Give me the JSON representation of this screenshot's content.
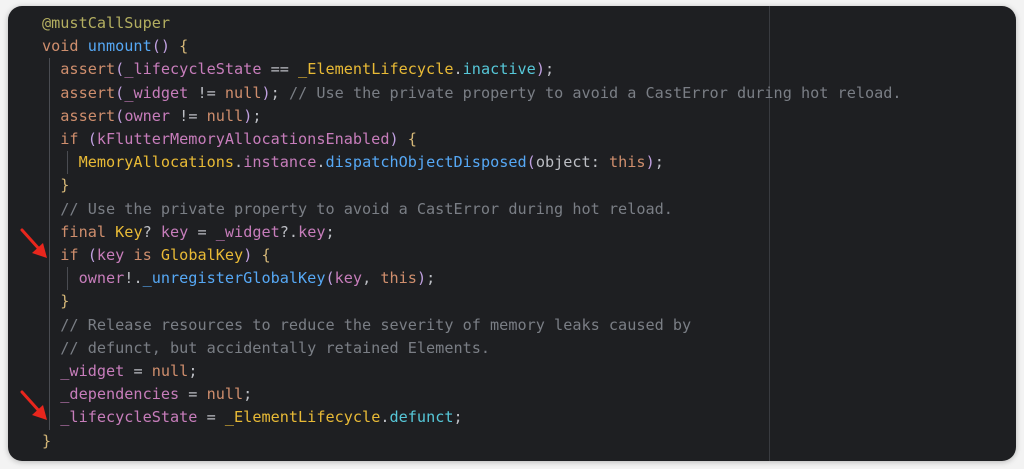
{
  "editor": {
    "lines": [
      [
        {
          "t": "@mustCallSuper",
          "c": "anno"
        }
      ],
      [
        {
          "t": "void ",
          "c": "kw"
        },
        {
          "t": "unmount",
          "c": "fn"
        },
        {
          "t": "() ",
          "c": "paren"
        },
        {
          "t": "{",
          "c": "brace"
        }
      ],
      [
        {
          "t": "  assert",
          "c": "kw"
        },
        {
          "t": "(",
          "c": "paren"
        },
        {
          "t": "_lifecycleState",
          "c": "priv"
        },
        {
          "t": " == ",
          "c": "punc"
        },
        {
          "t": "_ElementLifecycle",
          "c": "cls"
        },
        {
          "t": ".",
          "c": "punc"
        },
        {
          "t": "inactive",
          "c": "prop"
        },
        {
          "t": ")",
          "c": "paren"
        },
        {
          "t": ";",
          "c": "punc"
        }
      ],
      [
        {
          "t": "  assert",
          "c": "kw"
        },
        {
          "t": "(",
          "c": "paren"
        },
        {
          "t": "_widget",
          "c": "priv"
        },
        {
          "t": " != ",
          "c": "punc"
        },
        {
          "t": "null",
          "c": "kw"
        },
        {
          "t": ")",
          "c": "paren"
        },
        {
          "t": "; ",
          "c": "punc"
        },
        {
          "t": "// Use the private property to avoid a CastError during hot reload.",
          "c": "cm"
        }
      ],
      [
        {
          "t": "  assert",
          "c": "kw"
        },
        {
          "t": "(",
          "c": "paren"
        },
        {
          "t": "owner",
          "c": "priv"
        },
        {
          "t": " != ",
          "c": "punc"
        },
        {
          "t": "null",
          "c": "kw"
        },
        {
          "t": ")",
          "c": "paren"
        },
        {
          "t": ";",
          "c": "punc"
        }
      ],
      [
        {
          "t": "  if ",
          "c": "kw"
        },
        {
          "t": "(",
          "c": "paren"
        },
        {
          "t": "kFlutterMemoryAllocationsEnabled",
          "c": "priv"
        },
        {
          "t": ") ",
          "c": "paren"
        },
        {
          "t": "{",
          "c": "brace"
        }
      ],
      [
        {
          "t": "    MemoryAllocations",
          "c": "cls"
        },
        {
          "t": ".",
          "c": "punc"
        },
        {
          "t": "instance",
          "c": "priv"
        },
        {
          "t": ".",
          "c": "punc"
        },
        {
          "t": "dispatchObjectDisposed",
          "c": "fn"
        },
        {
          "t": "(",
          "c": "paren"
        },
        {
          "t": "object: ",
          "c": "named"
        },
        {
          "t": "this",
          "c": "this"
        },
        {
          "t": ")",
          "c": "paren"
        },
        {
          "t": ";",
          "c": "punc"
        }
      ],
      [
        {
          "t": "  }",
          "c": "brace"
        }
      ],
      [
        {
          "t": "  // Use the private property to avoid a CastError during hot reload.",
          "c": "cm"
        }
      ],
      [
        {
          "t": "  final ",
          "c": "kw"
        },
        {
          "t": "Key",
          "c": "cls"
        },
        {
          "t": "? ",
          "c": "punc"
        },
        {
          "t": "key",
          "c": "priv"
        },
        {
          "t": " = ",
          "c": "punc"
        },
        {
          "t": "_widget",
          "c": "priv"
        },
        {
          "t": "?.",
          "c": "punc"
        },
        {
          "t": "key",
          "c": "priv"
        },
        {
          "t": ";",
          "c": "punc"
        }
      ],
      [
        {
          "t": "  if ",
          "c": "kw"
        },
        {
          "t": "(",
          "c": "paren"
        },
        {
          "t": "key",
          "c": "priv"
        },
        {
          "t": " is ",
          "c": "kw"
        },
        {
          "t": "GlobalKey",
          "c": "cls"
        },
        {
          "t": ") ",
          "c": "paren"
        },
        {
          "t": "{",
          "c": "brace"
        }
      ],
      [
        {
          "t": "    owner",
          "c": "priv"
        },
        {
          "t": "!.",
          "c": "punc"
        },
        {
          "t": "_unregisterGlobalKey",
          "c": "fn"
        },
        {
          "t": "(",
          "c": "paren"
        },
        {
          "t": "key",
          "c": "priv"
        },
        {
          "t": ", ",
          "c": "punc"
        },
        {
          "t": "this",
          "c": "this"
        },
        {
          "t": ")",
          "c": "paren"
        },
        {
          "t": ";",
          "c": "punc"
        }
      ],
      [
        {
          "t": "  }",
          "c": "brace"
        }
      ],
      [
        {
          "t": "  // Release resources to reduce the severity of memory leaks caused by",
          "c": "cm"
        }
      ],
      [
        {
          "t": "  // defunct, but accidentally retained Elements.",
          "c": "cm"
        }
      ],
      [
        {
          "t": "  _widget",
          "c": "priv"
        },
        {
          "t": " = ",
          "c": "punc"
        },
        {
          "t": "null",
          "c": "kw"
        },
        {
          "t": ";",
          "c": "punc"
        }
      ],
      [
        {
          "t": "  _dependencies",
          "c": "priv"
        },
        {
          "t": " = ",
          "c": "punc"
        },
        {
          "t": "null",
          "c": "kw"
        },
        {
          "t": ";",
          "c": "punc"
        }
      ],
      [
        {
          "t": "  _lifecycleState",
          "c": "priv"
        },
        {
          "t": " = ",
          "c": "punc"
        },
        {
          "t": "_ElementLifecycle",
          "c": "cls"
        },
        {
          "t": ".",
          "c": "punc"
        },
        {
          "t": "defunct",
          "c": "prop"
        },
        {
          "t": ";",
          "c": "punc"
        }
      ],
      [
        {
          "t": "}",
          "c": "brace"
        }
      ]
    ],
    "arrows": [
      {
        "name": "annotation-arrow-if-globalkey",
        "line": 10
      },
      {
        "name": "annotation-arrow-lifecycle-defunct",
        "line": 17
      }
    ],
    "colors": {
      "background": "#1e1f22",
      "arrow": "#e8261d"
    }
  }
}
